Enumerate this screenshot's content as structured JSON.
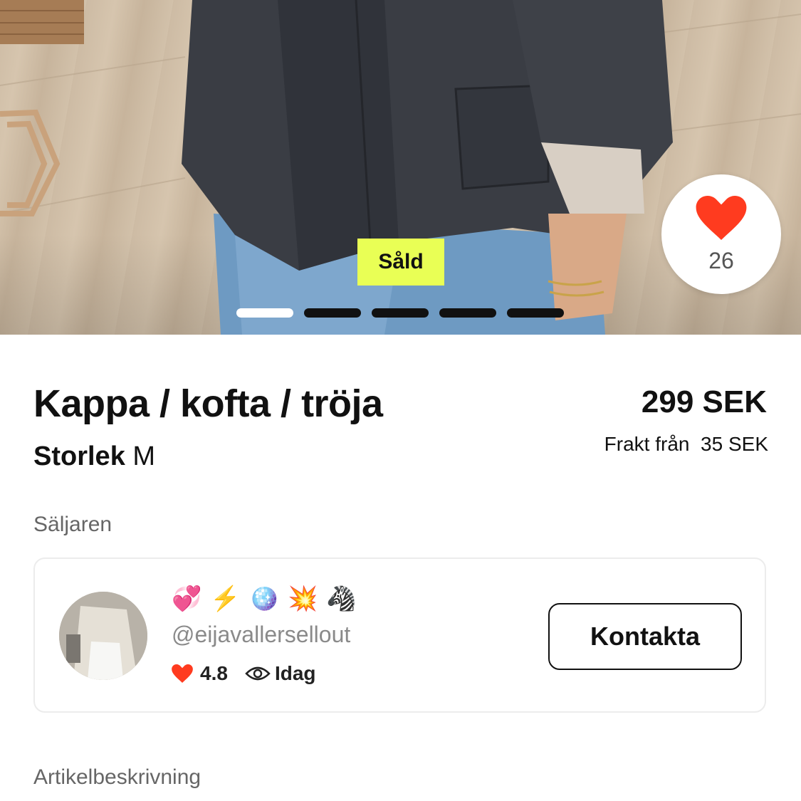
{
  "listing": {
    "status_badge": "Såld",
    "like_count": "26",
    "image_count": 5,
    "active_image": 1,
    "title": "Kappa / kofta / tröja",
    "size_label": "Storlek",
    "size_value": "M",
    "price": "299 SEK",
    "shipping": "Frakt från  35 SEK"
  },
  "seller": {
    "section_label": "Säljaren",
    "badges": [
      "💞",
      "⚡",
      "🪩",
      "💥",
      "🦓"
    ],
    "username": "@eijavallersellout",
    "rating": "4.8",
    "last_seen": "Idag",
    "contact_label": "Kontakta"
  },
  "description": {
    "section_label": "Artikelbeskrivning"
  },
  "colors": {
    "sold_badge": "#e9ff55",
    "heart": "#ff3b1f",
    "text": "#111111",
    "muted": "#666666"
  },
  "icons": [
    "heart-icon",
    "eye-icon"
  ]
}
